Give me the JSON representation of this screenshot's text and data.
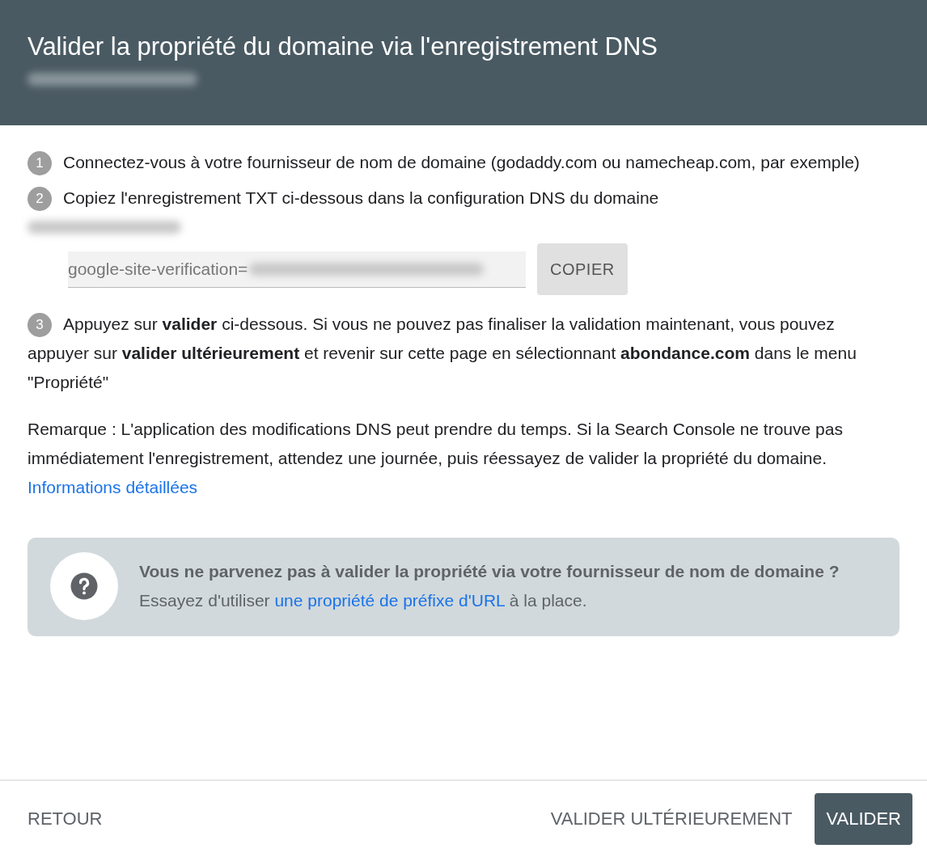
{
  "header": {
    "title": "Valider la propriété du domaine via l'enregistrement DNS"
  },
  "steps": [
    {
      "number": "1",
      "text": "Connectez-vous à votre fournisseur de nom de domaine (godaddy.com ou namecheap.com, par exemple)"
    },
    {
      "number": "2",
      "text": "Copiez l'enregistrement TXT ci-dessous dans la configuration DNS du domaine",
      "record": {
        "value": "google-site-verification=",
        "button": "COPIER"
      }
    },
    {
      "number": "3",
      "text": "Appuyez sur **valider** ci-dessous. Si vous ne pouvez pas finaliser la validation maintenant, vous pouvez appuyer sur **valider ultérieurement** et revenir sur cette page en sélectionnant **abondance.com** dans le menu \"Propriété\""
    }
  ],
  "note": "Remarque : L'application des modifications DNS peut prendre du temps. Si la Search Console ne trouve pas immédiatement l'enregistrement, attendez une journée, puis réessayez de valider la propriété du domaine.",
  "more_link": "Informations détaillées",
  "help": {
    "title": "Vous ne parvenez pas à valider la propriété via votre fournisseur de nom de domaine ?",
    "before": "Essayez d'utiliser ",
    "link": "une propriété de préfixe d'URL",
    "after": " à la place."
  },
  "footer": {
    "back": "RETOUR",
    "later": "VALIDER ULTÉRIEUREMENT",
    "confirm": "VALIDER"
  }
}
